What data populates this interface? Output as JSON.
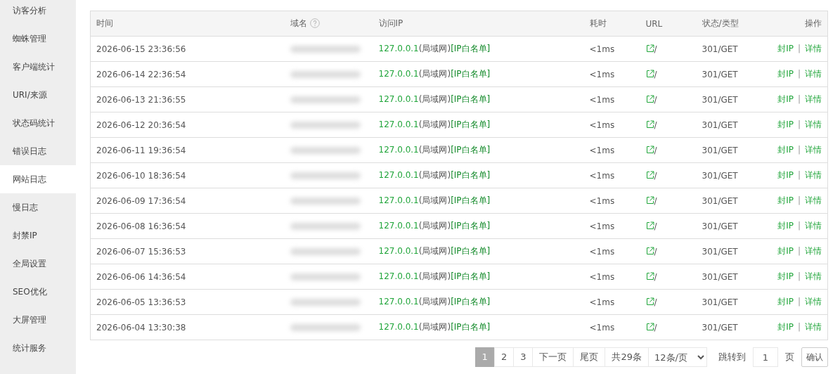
{
  "sidebar": {
    "items": [
      {
        "label": "访客分析",
        "selected": false
      },
      {
        "label": "蜘蛛管理",
        "selected": false
      },
      {
        "label": "客户端统计",
        "selected": false
      },
      {
        "label": "URI/来源",
        "selected": false
      },
      {
        "label": "状态码统计",
        "selected": false
      },
      {
        "label": "错误日志",
        "selected": false
      },
      {
        "label": "网站日志",
        "selected": true
      },
      {
        "label": "慢日志",
        "selected": false
      },
      {
        "label": "封禁IP",
        "selected": false
      },
      {
        "label": "全局设置",
        "selected": false
      },
      {
        "label": "SEO优化",
        "selected": false
      },
      {
        "label": "大屏管理",
        "selected": false
      },
      {
        "label": "统计服务",
        "selected": false
      }
    ]
  },
  "table": {
    "columns": [
      "时间",
      "域名",
      "访问IP",
      "耗时",
      "URL",
      "状态/类型",
      "操作"
    ],
    "rows": [
      {
        "time": "2026-06-15 23:36:56",
        "ip": "127.0.0.1",
        "ip_area": "(局域网)",
        "ip_tag": "[IP白名单]",
        "duration": "<1ms",
        "url": "/",
        "status": "301/GET",
        "actions": [
          "封IP",
          "|",
          "详情"
        ]
      },
      {
        "time": "2026-06-14 22:36:54",
        "ip": "127.0.0.1",
        "ip_area": "(局域网)",
        "ip_tag": "[IP白名单]",
        "duration": "<1ms",
        "url": "/",
        "status": "301/GET",
        "actions": [
          "封IP",
          "|",
          "详情"
        ]
      },
      {
        "time": "2026-06-13 21:36:55",
        "ip": "127.0.0.1",
        "ip_area": "(局域网)",
        "ip_tag": "[IP白名单]",
        "duration": "<1ms",
        "url": "/",
        "status": "301/GET",
        "actions": [
          "封IP",
          "|",
          "详情"
        ]
      },
      {
        "time": "2026-06-12 20:36:54",
        "ip": "127.0.0.1",
        "ip_area": "(局域网)",
        "ip_tag": "[IP白名单]",
        "duration": "<1ms",
        "url": "/",
        "status": "301/GET",
        "actions": [
          "封IP",
          "|",
          "详情"
        ]
      },
      {
        "time": "2026-06-11 19:36:54",
        "ip": "127.0.0.1",
        "ip_area": "(局域网)",
        "ip_tag": "[IP白名单]",
        "duration": "<1ms",
        "url": "/",
        "status": "301/GET",
        "actions": [
          "封IP",
          "|",
          "详情"
        ]
      },
      {
        "time": "2026-06-10 18:36:54",
        "ip": "127.0.0.1",
        "ip_area": "(局域网)",
        "ip_tag": "[IP白名单]",
        "duration": "<1ms",
        "url": "/",
        "status": "301/GET",
        "actions": [
          "封IP",
          "|",
          "详情"
        ]
      },
      {
        "time": "2026-06-09 17:36:54",
        "ip": "127.0.0.1",
        "ip_area": "(局域网)",
        "ip_tag": "[IP白名单]",
        "duration": "<1ms",
        "url": "/",
        "status": "301/GET",
        "actions": [
          "封IP",
          "|",
          "详情"
        ]
      },
      {
        "time": "2026-06-08 16:36:54",
        "ip": "127.0.0.1",
        "ip_area": "(局域网)",
        "ip_tag": "[IP白名单]",
        "duration": "<1ms",
        "url": "/",
        "status": "301/GET",
        "actions": [
          "封IP",
          "|",
          "详情"
        ]
      },
      {
        "time": "2026-06-07 15:36:53",
        "ip": "127.0.0.1",
        "ip_area": "(局域网)",
        "ip_tag": "[IP白名单]",
        "duration": "<1ms",
        "url": "/",
        "status": "301/GET",
        "actions": [
          "封IP",
          "|",
          "详情"
        ]
      },
      {
        "time": "2026-06-06 14:36:54",
        "ip": "127.0.0.1",
        "ip_area": "(局域网)",
        "ip_tag": "[IP白名单]",
        "duration": "<1ms",
        "url": "/",
        "status": "301/GET",
        "actions": [
          "封IP",
          "|",
          "详情"
        ]
      },
      {
        "time": "2026-06-05 13:36:53",
        "ip": "127.0.0.1",
        "ip_area": "(局域网)",
        "ip_tag": "[IP白名单]",
        "duration": "<1ms",
        "url": "/",
        "status": "301/GET",
        "actions": [
          "封IP",
          "|",
          "详情"
        ]
      },
      {
        "time": "2026-06-04 13:30:38",
        "ip": "127.0.0.1",
        "ip_area": "(局域网)",
        "ip_tag": "[IP白名单]",
        "duration": "<1ms",
        "url": "/",
        "status": "301/GET",
        "actions": [
          "封IP",
          "|",
          "详情"
        ]
      }
    ]
  },
  "pagination": {
    "pages": [
      {
        "label": "1",
        "selected": true
      },
      {
        "label": "2",
        "selected": false
      },
      {
        "label": "3",
        "selected": false
      }
    ],
    "next": "下一页",
    "last": "尾页",
    "total": "共29条",
    "page_size": "12条/页",
    "jump_label": "跳转到",
    "jump_value": "1",
    "page_unit": "页",
    "confirm": "确认"
  }
}
